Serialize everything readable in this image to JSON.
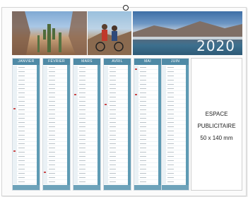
{
  "calendar": {
    "year": "2020",
    "photos": [
      "cactus-landscape-photo",
      "cyclists-photo",
      "mountain-lake-photo"
    ],
    "months": [
      "JANVIER",
      "FÉVRIER",
      "MARS",
      "AVRIL",
      "MAI",
      "JUIN"
    ],
    "accent_color": "#4f8aa6"
  },
  "ad_space": {
    "line1": "ESPACE",
    "line2": "PUBLICITAIRE",
    "line3": "50 x 140 mm"
  }
}
